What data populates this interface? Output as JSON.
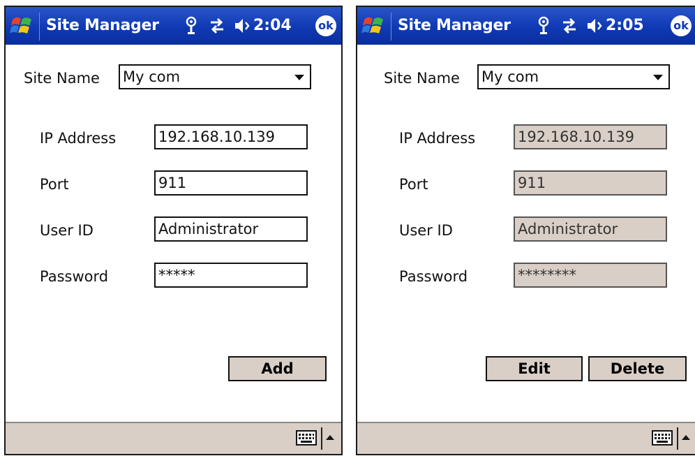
{
  "screens": [
    {
      "title": "Site Manager",
      "time": "2:04",
      "ok_label": "ok",
      "site_name_label": "Site Name",
      "site_name_value": "My com",
      "fields": [
        {
          "label": "IP Address",
          "value": "192.168.10.139"
        },
        {
          "label": "Port",
          "value": "911"
        },
        {
          "label": "User ID",
          "value": "Administrator"
        },
        {
          "label": "Password",
          "value": "*****"
        }
      ],
      "buttons": [
        "Add"
      ]
    },
    {
      "title": "Site Manager",
      "time": "2:05",
      "ok_label": "ok",
      "site_name_label": "Site Name",
      "site_name_value": "My com",
      "fields": [
        {
          "label": "IP Address",
          "value": "192.168.10.139"
        },
        {
          "label": "Port",
          "value": "911"
        },
        {
          "label": "User ID",
          "value": "Administrator"
        },
        {
          "label": "Password",
          "value": "********"
        }
      ],
      "buttons": [
        "Edit",
        "Delete"
      ]
    }
  ],
  "icons": [
    "windows-start-icon",
    "antenna-icon",
    "connectivity-icon",
    "speaker-icon",
    "keyboard-icon",
    "chevron-up-icon"
  ],
  "colors": {
    "titlebar": "#0f39b4",
    "readonly_field": "#d9cfc7",
    "menubar": "#d9cfc7"
  }
}
